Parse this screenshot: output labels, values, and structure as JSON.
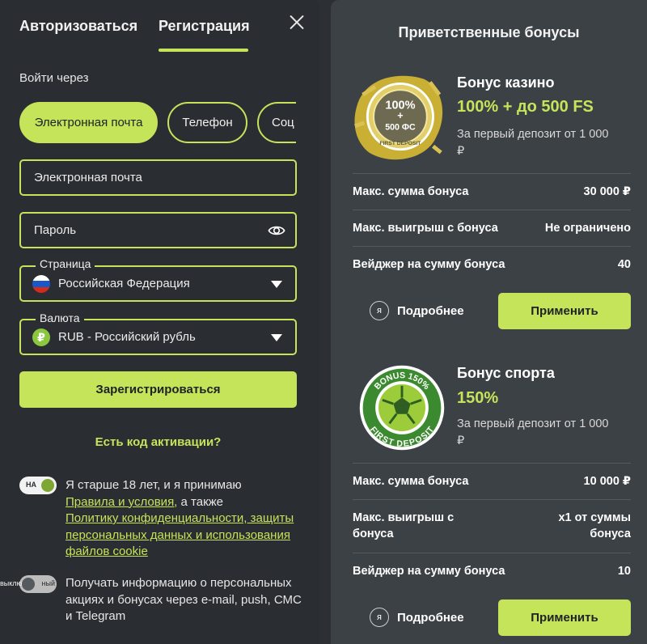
{
  "tabs": {
    "login": "Авторизоваться",
    "register": "Регистрация"
  },
  "form": {
    "login_via": "Войти через",
    "methods": [
      "Электронная почта",
      "Телефон",
      "Соц"
    ],
    "email_placeholder": "Электронная почта",
    "password_placeholder": "Пароль",
    "country_label": "Страница",
    "country_value": "Российская Федерация",
    "currency_label": "Валюта",
    "currency_value": "RUB - Российский рубль",
    "currency_symbol": "₽",
    "register_button": "Зарегистрироваться",
    "activation_link": "Есть код активации?",
    "toggle_on_label": "НА",
    "toggle_off_label": "ный",
    "toggle_off_prefix": "выклю",
    "consent_prefix": "Я старше 18 лет, и я принимаю",
    "consent_terms": "Правила и условия,",
    "consent_middle": " а также",
    "consent_privacy": "Политику конфиденциальности, защиты персональных данных и использования файлов cookie",
    "newsletter": "Получать информацию о персональных акциях и бонусах через e-mail, push, СМС и Telegram"
  },
  "bonuses": {
    "title": "Приветственные бонусы",
    "more_icon_text": "я",
    "casino": {
      "badge_line1": "100%",
      "badge_plus": "+",
      "badge_line2": "500 ФС",
      "badge_ribbon": "FIRST DEPOSIT",
      "name": "Бонус казино",
      "amount": "100% + до 500 FS",
      "condition": "За первый депозит от 1 000 ₽",
      "rows": [
        {
          "label": "Макс. сумма бонуса",
          "value": "30 000 ₽"
        },
        {
          "label": "Макс. выигрыш с бонуса",
          "value": "Не ограничено"
        },
        {
          "label": "Вейджер на сумму бонуса",
          "value": "40"
        }
      ],
      "more": "Подробнее",
      "apply": "Применить"
    },
    "sport": {
      "badge_top": "BONUS 150%",
      "badge_bottom": "FIRST DEPOSIT",
      "name": "Бонус спорта",
      "amount": "150%",
      "condition": "За первый депозит от 1 000 ₽",
      "rows": [
        {
          "label": "Макс. сумма бонуса",
          "value": "10 000 ₽"
        },
        {
          "label": "Макс. выигрыш с бонуса",
          "value": "х1 от суммы бонуса"
        },
        {
          "label": "Вейджер на сумму бонуса",
          "value": "10"
        }
      ],
      "more": "Подробнее",
      "apply": "Применить"
    }
  },
  "colors": {
    "accent": "#c5e45a",
    "panel_left": "#2a2d31",
    "panel_right": "#3c4146"
  }
}
